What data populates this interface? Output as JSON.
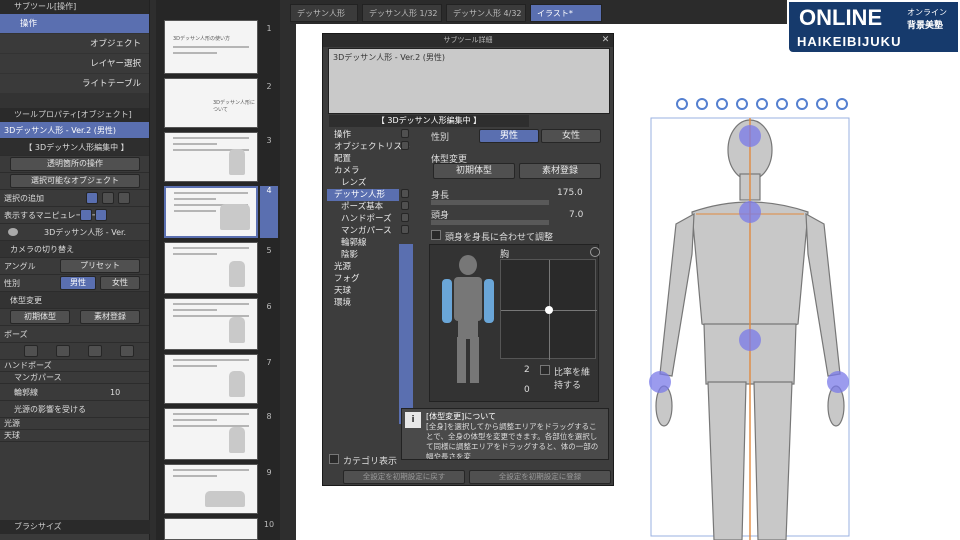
{
  "left_panel": {
    "subtool_header": "サブツール[操作]",
    "subtool_category": "操作",
    "subtools": [
      "オブジェクト",
      "レイヤー選択",
      "ライトテーブル"
    ],
    "tool_property_header": "ツールプロパティ[オブジェクト]",
    "model_name": "3Dデッサン人形 - Ver.2 (男性)",
    "edit_badge": "【 3Dデッサン人形編集中 】",
    "transparent_select": "透明箇所の操作",
    "select_object": "選択可能なオブジェクト",
    "select_add": "選択の追加",
    "show_manipulator": "表示するマニピュレーター",
    "layer_row": "3Dデッサン人形 - Ver.",
    "camera_toggle": "カメラの切り替え",
    "angle_label": "アングル",
    "preset_label": "プリセット",
    "gender_label": "性別",
    "male": "男性",
    "female": "女性",
    "body_change": "体型変更",
    "initial_body": "初期体型",
    "register_material": "素材登録",
    "pose_label": "ポーズ",
    "hand_pose": "ハンドポーズ",
    "manga_perspective": "マンガパース",
    "outline": "輪郭線",
    "outline_value": "10",
    "light_source_effect": "光源の影響を受ける",
    "light_source": "光源",
    "sky": "天球",
    "brush_size_header": "ブラシサイズ"
  },
  "thumbnails": {
    "numbers": [
      "1",
      "2",
      "3",
      "4",
      "5",
      "6",
      "7",
      "8",
      "9",
      "10"
    ],
    "page1_text": "3Dデッサン人形の使い方",
    "page2_text": "3Dデッサン人形について"
  },
  "tabs": [
    "デッサン人形",
    "デッサン人形 1/32",
    "デッサン人形 4/32",
    "イラスト*"
  ],
  "dialog": {
    "title": "サブツール詳細",
    "preview_name": "3Dデッサン人形 - Ver.2 (男性)",
    "edit_badge": "【 3Dデッサン人形編集中 】",
    "categories": [
      {
        "label": "操作",
        "sub": false,
        "sel": false
      },
      {
        "label": "オブジェクトリスト",
        "sub": false,
        "sel": false
      },
      {
        "label": "配置",
        "sub": false,
        "sel": false
      },
      {
        "label": "カメラ",
        "sub": false,
        "sel": false
      },
      {
        "label": "レンズ",
        "sub": true,
        "sel": false
      },
      {
        "label": "デッサン人形",
        "sub": false,
        "sel": true
      },
      {
        "label": "ポーズ基本",
        "sub": true,
        "sel": false
      },
      {
        "label": "ハンドポーズ",
        "sub": true,
        "sel": false
      },
      {
        "label": "マンガパース",
        "sub": true,
        "sel": false
      },
      {
        "label": "輪郭線",
        "sub": true,
        "sel": false
      },
      {
        "label": "陰影",
        "sub": true,
        "sel": false
      },
      {
        "label": "光源",
        "sub": false,
        "sel": false
      },
      {
        "label": "フォグ",
        "sub": false,
        "sel": false
      },
      {
        "label": "天球",
        "sub": false,
        "sel": false
      },
      {
        "label": "環境",
        "sub": false,
        "sel": false
      }
    ],
    "gender_label": "性別",
    "male": "男性",
    "female": "女性",
    "body_change": "体型変更",
    "initial_body": "初期体型",
    "register_material": "素材登録",
    "height_label": "身長",
    "height_value": "175.0",
    "head_label": "頭身",
    "head_value": "7.0",
    "adjust_checkbox": "頭身を身長に合わせて調整",
    "chest_label": "胸",
    "spin_top": "2",
    "spin_bottom": "0",
    "keep_ratio": "比率を維持する",
    "info_title": "[体型変更]について",
    "info_body": "[全身]を選択してから調整エリアをドラッグすることで、全身の体型を変更できます。各部位を選択して同様に調整エリアをドラッグすると、体の一部の幅や長さを変",
    "show_category": "カテゴリ表示",
    "reset_all": "全設定を初期設定に戻す",
    "register_default": "全設定を初期設定に登録"
  },
  "logo": {
    "top": "ONLINE",
    "sub1": "オンライン",
    "sub2": "背景美塾",
    "bottom": "HAIKEIBIJUKU"
  }
}
